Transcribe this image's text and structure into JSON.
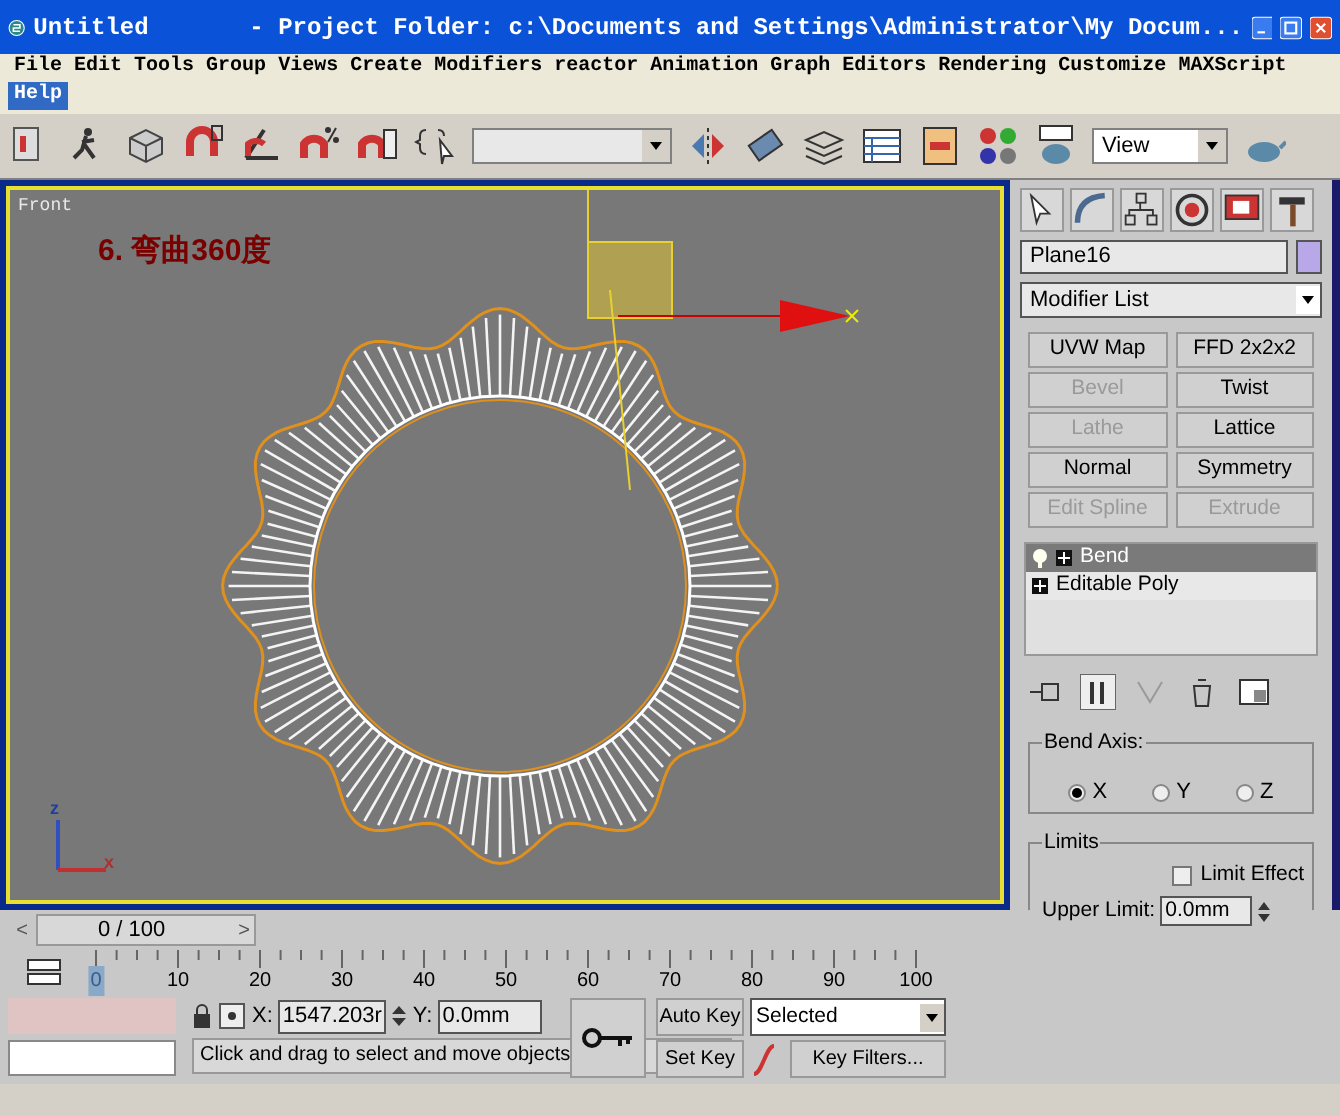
{
  "window": {
    "title": "Untitled       - Project Folder: c:\\Documents and Settings\\Administrator\\My Docum..."
  },
  "menu": [
    {
      "label": "File",
      "selected": false
    },
    {
      "label": "Edit",
      "selected": false
    },
    {
      "label": "Tools",
      "selected": false
    },
    {
      "label": "Group",
      "selected": false
    },
    {
      "label": "Views",
      "selected": false
    },
    {
      "label": "Create",
      "selected": false
    },
    {
      "label": "Modifiers",
      "selected": false
    },
    {
      "label": "reactor",
      "selected": false
    },
    {
      "label": "Animation",
      "selected": false
    },
    {
      "label": "Graph Editors",
      "selected": false
    },
    {
      "label": "Rendering",
      "selected": false
    },
    {
      "label": "Customize",
      "selected": false
    },
    {
      "label": "MAXScript",
      "selected": false
    },
    {
      "label": "Help",
      "selected": true
    }
  ],
  "toolbar": {
    "view_dropdown": "View"
  },
  "viewport": {
    "label": "Front",
    "caption": "6. 弯曲360度",
    "axis_labels": [
      "z",
      "x"
    ]
  },
  "command_panel": {
    "object_name": "Plane16",
    "modifier_list": "Modifier List",
    "modifier_buttons": [
      {
        "label": "UVW Map",
        "disabled": false
      },
      {
        "label": "FFD 2x2x2",
        "disabled": false
      },
      {
        "label": "Bevel",
        "disabled": true
      },
      {
        "label": "Twist",
        "disabled": false
      },
      {
        "label": "Lathe",
        "disabled": true
      },
      {
        "label": "Lattice",
        "disabled": false
      },
      {
        "label": "Normal",
        "disabled": false
      },
      {
        "label": "Symmetry",
        "disabled": false
      },
      {
        "label": "Edit Spline",
        "disabled": true
      },
      {
        "label": "Extrude",
        "disabled": true
      }
    ],
    "stack": [
      {
        "label": "Bend",
        "selected": true
      },
      {
        "label": "Editable Poly",
        "selected": false
      }
    ],
    "bend_axis": {
      "title": "Bend Axis:",
      "options": [
        {
          "label": "X",
          "selected": true
        },
        {
          "label": "Y",
          "selected": false
        },
        {
          "label": "Z",
          "selected": false
        }
      ]
    },
    "limits": {
      "title": "Limits",
      "limit_effect": {
        "label": "Limit Effect",
        "checked": false
      },
      "upper_limit": {
        "label": "Upper Limit:",
        "value": "0.0mm"
      }
    }
  },
  "time_slider": {
    "label": "0 / 100",
    "level": 0,
    "prev": "<",
    "next": ">"
  },
  "ruler": {
    "ticks": [
      "0",
      "10",
      "20",
      "30",
      "40",
      "50",
      "60",
      "70",
      "80",
      "90",
      "100"
    ]
  },
  "status": {
    "x_value": "1547.203r",
    "y_value": "0.0mm",
    "x_label": "X:",
    "y_label": "Y:",
    "prompt": "Click and drag to select and move objects",
    "auto_key": "Auto Key",
    "set_key": "Set Key",
    "key_mode": "Selected",
    "key_filters": "Key Filters..."
  }
}
